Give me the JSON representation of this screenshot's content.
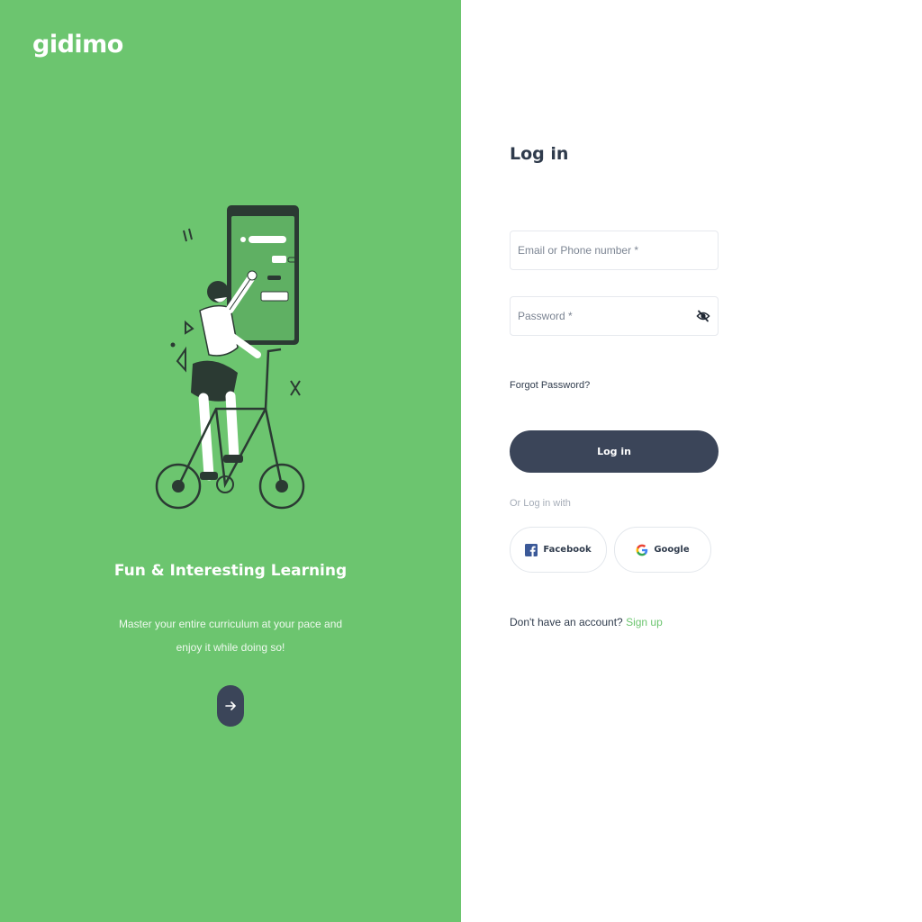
{
  "brand": {
    "logo_text": "gidimo",
    "accent_color": "#6cc56f",
    "dark_color": "#3b4559"
  },
  "hero": {
    "title": "Fun & Interesting Learning",
    "subtitle": "Master your entire curriculum at your pace and enjoy it while doing so!",
    "next_icon": "arrow-right-icon"
  },
  "login": {
    "title": "Log in",
    "email_placeholder": "Email or Phone number *",
    "email_value": "",
    "password_placeholder": "Password *",
    "password_value": "",
    "password_toggle_icon": "eye-slash-icon",
    "forgot_password": "Forgot Password?",
    "submit_label": "Log in",
    "or_text": "Or Log in with",
    "facebook_label": "Facebook",
    "google_label": "Google",
    "no_account_text": "Don't have an account?",
    "signup_label": "Sign up"
  }
}
